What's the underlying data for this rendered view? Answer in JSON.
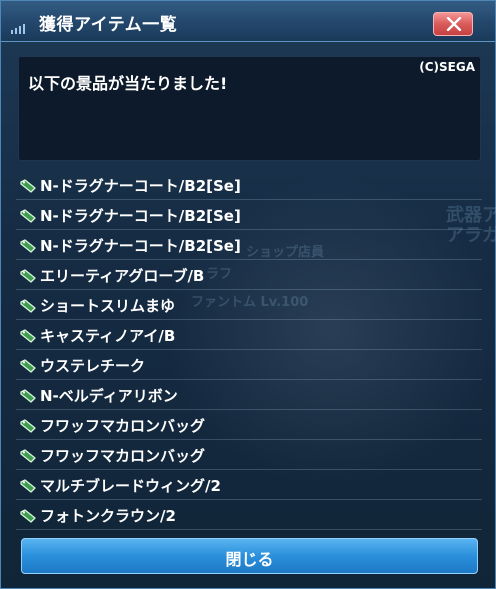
{
  "window": {
    "title": "獲得アイテム一覧",
    "close_icon": "x-icon"
  },
  "message_box": {
    "copyright": "(C)SEGA",
    "text": "以下の景品が当たりました!"
  },
  "background_text": {
    "line1": "武器ア",
    "line2": "アラガ",
    "line3": "ショップ店員",
    "line4": "ファントム Lv.100",
    "line5": "ラフ"
  },
  "items": [
    {
      "label": "N-ドラグナーコート/B2[Se]",
      "icon": "tag-icon"
    },
    {
      "label": "N-ドラグナーコート/B2[Se]",
      "icon": "tag-icon"
    },
    {
      "label": "N-ドラグナーコート/B2[Se]",
      "icon": "tag-icon"
    },
    {
      "label": "エリーティアグローブ/B",
      "icon": "tag-icon"
    },
    {
      "label": "ショートスリムまゆ",
      "icon": "tag-icon"
    },
    {
      "label": "キャスティノアイ/B",
      "icon": "tag-icon"
    },
    {
      "label": "ウステレチーク",
      "icon": "tag-icon"
    },
    {
      "label": "N-ベルディアリボン",
      "icon": "tag-icon"
    },
    {
      "label": "フワッフマカロンバッグ",
      "icon": "tag-icon"
    },
    {
      "label": "フワッフマカロンバッグ",
      "icon": "tag-icon"
    },
    {
      "label": "マルチブレードウィング/2",
      "icon": "tag-icon"
    },
    {
      "label": "フォトンクラウン/2",
      "icon": "tag-icon"
    }
  ],
  "footer": {
    "close_label": "閉じる"
  },
  "colors": {
    "title_bar": "#23476b",
    "close_x": "#d95b5b",
    "button": "#2a8fdb",
    "icon_green": "#3f9d4e"
  }
}
